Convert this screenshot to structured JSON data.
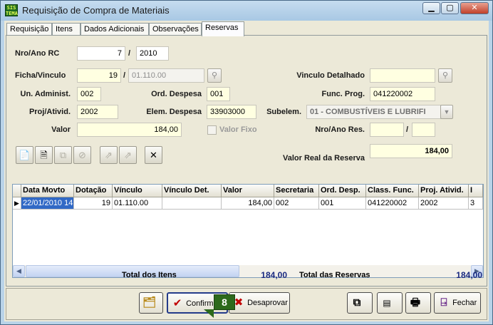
{
  "window": {
    "title": "Requisição de Compra de Materiais",
    "app_icon_text": "SISTEMA"
  },
  "tabs": [
    "Requisição",
    "Itens",
    "Dados Adicionais",
    "Observações",
    "Reservas"
  ],
  "active_tab": "Reservas",
  "form": {
    "nro_ano_rc_label": "Nro/Ano RC",
    "nro_rc": "7",
    "ano_rc": "2010",
    "slash": "/",
    "ficha_vinculo_label": "Ficha/Vinculo",
    "ficha": "19",
    "vinculo": "01.110.00",
    "vinculo_detalhado_label": "Vinculo Detalhado",
    "vinculo_detalhado": "",
    "un_administ_label": "Un. Administ.",
    "un_administ": "002",
    "ord_despesa_label": "Ord. Despesa",
    "ord_despesa": "001",
    "func_prog_label": "Func. Prog.",
    "func_prog": "041220002",
    "proj_ativid_label": "Proj/Ativid.",
    "proj_ativid": "2002",
    "elem_despesa_label": "Elem. Despesa",
    "elem_despesa": "33903000",
    "subelem_label": "Subelem.",
    "subelem": "01 - COMBUSTÍVEIS E LUBRIFI",
    "valor_label": "Valor",
    "valor": "184,00",
    "valor_fixo_label": "Valor Fixo",
    "nro_ano_res_label": "Nro/Ano Res.",
    "nro_res": "",
    "ano_res": "",
    "valor_real_label": "Valor Real da Reserva",
    "valor_real": "184,00"
  },
  "grid": {
    "columns": [
      "Data Movto",
      "Dotação",
      "Vínculo",
      "Vínculo Det.",
      "Valor",
      "Secretaria",
      "Ord. Desp.",
      "Class. Func.",
      "Proj. Ativid.",
      "I"
    ],
    "rows": [
      [
        "22/01/2010 14",
        "19",
        "01.110.00",
        "",
        "184,00",
        "002",
        "001",
        "041220002",
        "2002",
        "3"
      ]
    ]
  },
  "totals": {
    "itens_label": "Total dos Itens",
    "itens_value": "184,00",
    "reservas_label": "Total das Reservas",
    "reservas_value": "184,00"
  },
  "buttons": {
    "confirmar": "Confirmar",
    "desaprovar": "Desaprovar",
    "fechar": "Fechar"
  },
  "callout": "8"
}
